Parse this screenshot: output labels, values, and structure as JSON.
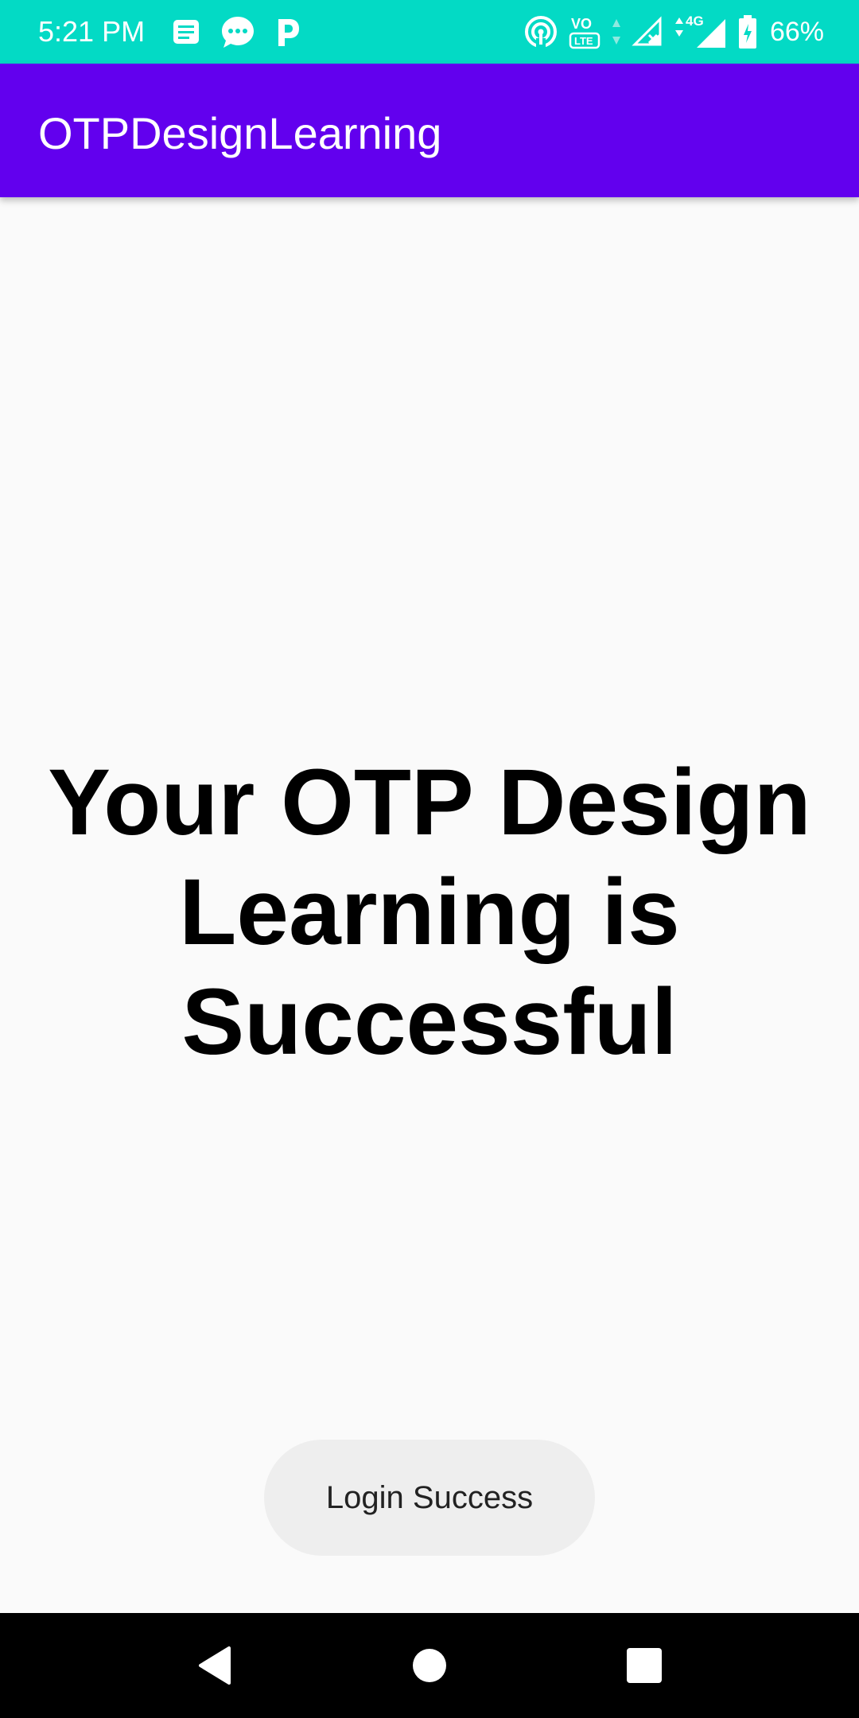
{
  "status_bar": {
    "time": "5:21 PM",
    "battery_percent": "66%",
    "background_color": "#03dac5",
    "left_icons": [
      "sms-notification-icon",
      "chat-notification-icon",
      "parking-app-icon"
    ],
    "right_icons": [
      "hotspot-icon",
      "volte-icon",
      "data-activity-icon",
      "signal-no-service-icon",
      "4g-signal-icon",
      "battery-charging-icon"
    ],
    "volte_label": "VO",
    "lte_label": "LTE",
    "network_label": "4G"
  },
  "app_bar": {
    "title": "OTPDesignLearning",
    "background_color": "#6200ee"
  },
  "main": {
    "message": "Your OTP Design Learning is Successful"
  },
  "toast": {
    "text": "Login Success"
  },
  "nav_bar": {
    "buttons": [
      "back-icon",
      "home-icon",
      "recents-icon"
    ]
  }
}
